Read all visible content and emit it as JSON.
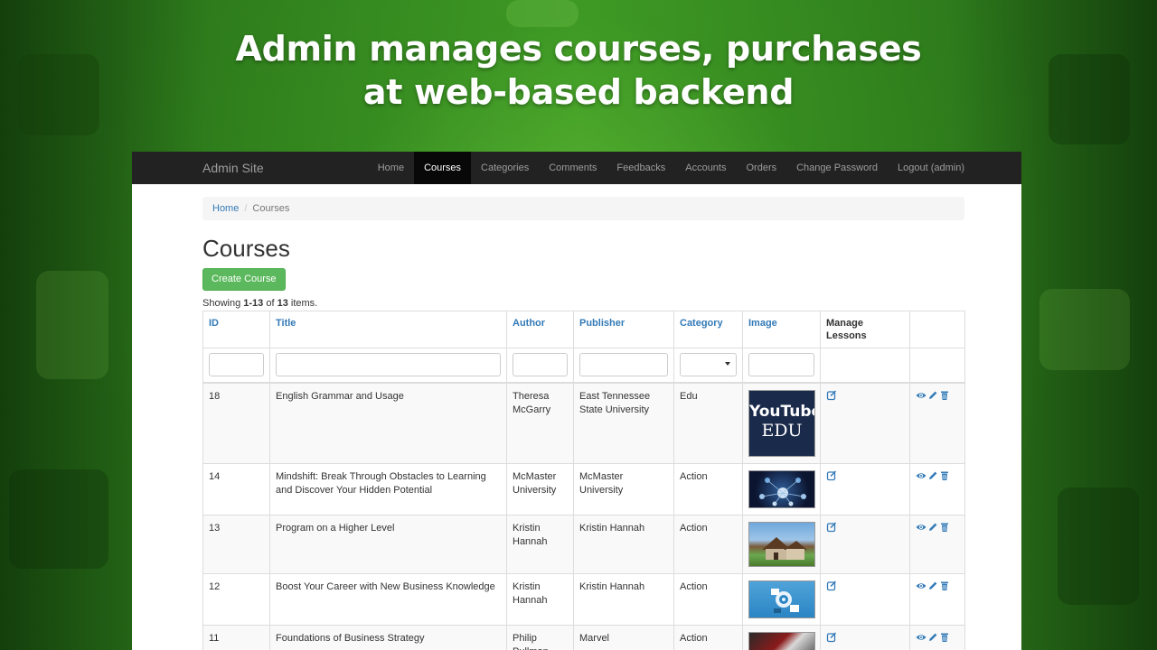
{
  "headline": {
    "line1": "Admin manages courses, purchases",
    "line2": "at web-based backend"
  },
  "navbar": {
    "brand": "Admin Site",
    "items": [
      {
        "label": "Home",
        "active": false
      },
      {
        "label": "Courses",
        "active": true
      },
      {
        "label": "Categories",
        "active": false
      },
      {
        "label": "Comments",
        "active": false
      },
      {
        "label": "Feedbacks",
        "active": false
      },
      {
        "label": "Accounts",
        "active": false
      },
      {
        "label": "Orders",
        "active": false
      },
      {
        "label": "Change Password",
        "active": false
      },
      {
        "label": "Logout (admin)",
        "active": false
      }
    ]
  },
  "breadcrumb": {
    "home": "Home",
    "separator": "/",
    "current": "Courses"
  },
  "page": {
    "title": "Courses",
    "create_button": "Create Course",
    "summary": {
      "prefix": "Showing ",
      "range": "1-13",
      "of": " of ",
      "total": "13",
      "suffix": " items."
    }
  },
  "table": {
    "columns": [
      "ID",
      "Title",
      "Author",
      "Publisher",
      "Category",
      "Image",
      "Manage Lessons",
      ""
    ],
    "rows": [
      {
        "id": "18",
        "title": "English Grammar and Usage",
        "author": "Theresa McGarry",
        "publisher": "East Tennessee State University",
        "category": "Edu",
        "image": "youtube-edu",
        "image_text_top": "YouTube",
        "image_text_bottom": "EDU"
      },
      {
        "id": "14",
        "title": "Mindshift: Break Through Obstacles to Learning and Discover Your Hidden Potential",
        "author": "McMaster University",
        "publisher": "McMaster University",
        "category": "Action",
        "image": "mind-network"
      },
      {
        "id": "13",
        "title": "Program on a Higher Level",
        "author": "Kristin Hannah",
        "publisher": "Kristin Hannah",
        "category": "Action",
        "image": "house"
      },
      {
        "id": "12",
        "title": "Boost Your Career with New Business Knowledge",
        "author": "Kristin Hannah",
        "publisher": "Kristin Hannah",
        "category": "Action",
        "image": "business-icons"
      },
      {
        "id": "11",
        "title": "Foundations of Business Strategy",
        "author": "Philip Pullman",
        "publisher": "Marvel",
        "category": "Action",
        "image": "books"
      }
    ]
  },
  "icons": {
    "manage": "edit-square-icon",
    "view": "eye-icon",
    "update": "pencil-icon",
    "delete": "trash-icon"
  },
  "colors": {
    "accent": "#337ab7",
    "success": "#5cb85c",
    "navbar": "#222222",
    "background_green": "#2f7d1f"
  }
}
